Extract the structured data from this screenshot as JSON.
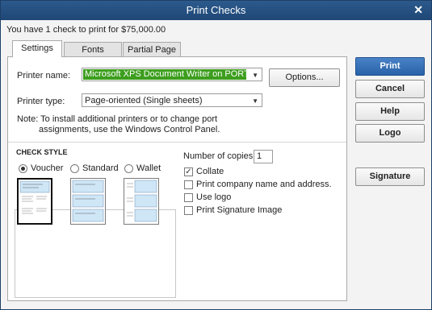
{
  "window": {
    "title": "Print Checks",
    "close_glyph": "✕"
  },
  "summary": "You have 1 check to print for $75,000.00",
  "tabs": [
    {
      "label": "Settings",
      "active": true
    },
    {
      "label": "Fonts",
      "active": false
    },
    {
      "label": "Partial Page",
      "active": false
    }
  ],
  "printer": {
    "name_label": "Printer name:",
    "name_value": "Microsoft XPS Document Writer on PORTP...",
    "type_label": "Printer type:",
    "type_value": "Page-oriented (Single sheets)",
    "options_button": "Options...",
    "note": "Note: To install additional printers or to change port",
    "note_line2": "assignments, use the Windows Control Panel."
  },
  "check_style": {
    "heading": "CHECK STYLE",
    "options": [
      {
        "label": "Voucher",
        "selected": true
      },
      {
        "label": "Standard",
        "selected": false
      },
      {
        "label": "Wallet",
        "selected": false
      }
    ]
  },
  "copies": {
    "label": "Number of copies:",
    "value": "1"
  },
  "checkboxes": [
    {
      "label": "Collate",
      "checked": true
    },
    {
      "label": "Print company name and address.",
      "checked": false
    },
    {
      "label": "Use logo",
      "checked": false
    },
    {
      "label": "Print Signature Image",
      "checked": false
    }
  ],
  "buttons": {
    "print": "Print",
    "cancel": "Cancel",
    "help": "Help",
    "logo": "Logo",
    "signature": "Signature"
  },
  "colors": {
    "titlebar": "#1f4776",
    "selection": "#3d9e1e",
    "primary": "#2862a8"
  }
}
